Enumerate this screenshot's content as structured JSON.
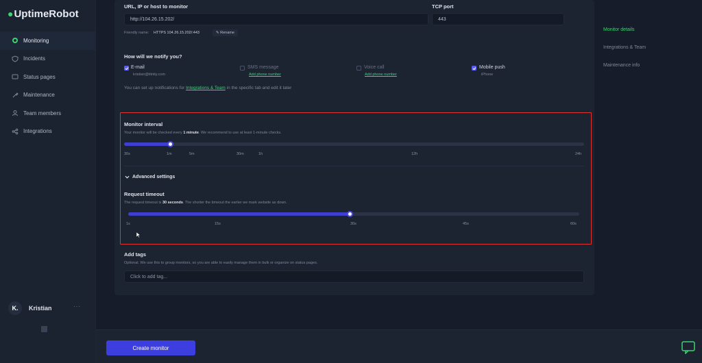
{
  "app": {
    "logo_text": "UptimeRobot",
    "accent": "#3bd671",
    "primary": "#3d3ee0"
  },
  "sidebar": {
    "items": [
      {
        "label": "Monitoring",
        "icon": "monitoring-icon",
        "active": true
      },
      {
        "label": "Incidents",
        "icon": "incidents-icon"
      },
      {
        "label": "Status pages",
        "icon": "status-pages-icon"
      },
      {
        "label": "Maintenance",
        "icon": "maintenance-icon"
      },
      {
        "label": "Team members",
        "icon": "team-icon"
      },
      {
        "label": "Integrations",
        "icon": "integrations-icon"
      }
    ],
    "user": {
      "initial": "K.",
      "name": "Kristian",
      "more": "···"
    }
  },
  "form": {
    "url_label": "URL, IP or host to monitor",
    "url_value": "http://104.26.15.202/",
    "port_label": "TCP port",
    "port_value": "443",
    "friendly_name_prefix": "Friendly name:",
    "friendly_name_value": "HTTPS 104.26.15.202/:443",
    "rename_label": "Rename",
    "notify_title": "How will we notify you?",
    "notify_options": [
      {
        "label": "E-mail",
        "sub": "kristian@itinity.com",
        "checked": true
      },
      {
        "label": "SMS message",
        "sub": "Add phone number",
        "checked": false,
        "sub_is_link": true
      },
      {
        "label": "Voice call",
        "sub": "Add phone number",
        "checked": false,
        "sub_is_link": true
      },
      {
        "label": "Mobile push",
        "sub": "iPhone",
        "checked": true
      }
    ],
    "notify_hint_before": "You can set up notifications for",
    "notify_hint_link": "Integrations & Team",
    "notify_hint_after": "in the specific tab and edit it later",
    "interval": {
      "title": "Monitor interval",
      "hint_before": "Your monitor will be checked every",
      "hint_value": "1 minute",
      "hint_after": ". We recommend to use at least 1-minute checks.",
      "ticks": [
        "30s",
        "1m",
        "5m",
        "30m",
        "1h",
        "12h",
        "24h"
      ],
      "level_fraction": 0.1
    },
    "advanced_label": "Advanced settings",
    "timeout": {
      "title": "Request timeout",
      "hint_before": "The request timeout is",
      "hint_value": "30 seconds",
      "hint_after": ". The shorter the timeout the earlier we mark website as down.",
      "ticks": [
        "1s",
        "15s",
        "30s",
        "45s",
        "60s"
      ],
      "value_seconds": 30
    },
    "tags": {
      "title": "Add tags",
      "hint": "Optional. We use this to group monitors, so you are able to easily manage them in bulk or organize on status pages.",
      "placeholder": "Click to add tag..."
    }
  },
  "right_menu": {
    "items": [
      {
        "label": "Monitor details",
        "active": true
      },
      {
        "label": "Integrations & Team"
      },
      {
        "label": "Maintenance info"
      }
    ]
  },
  "footer": {
    "create_label": "Create monitor"
  }
}
